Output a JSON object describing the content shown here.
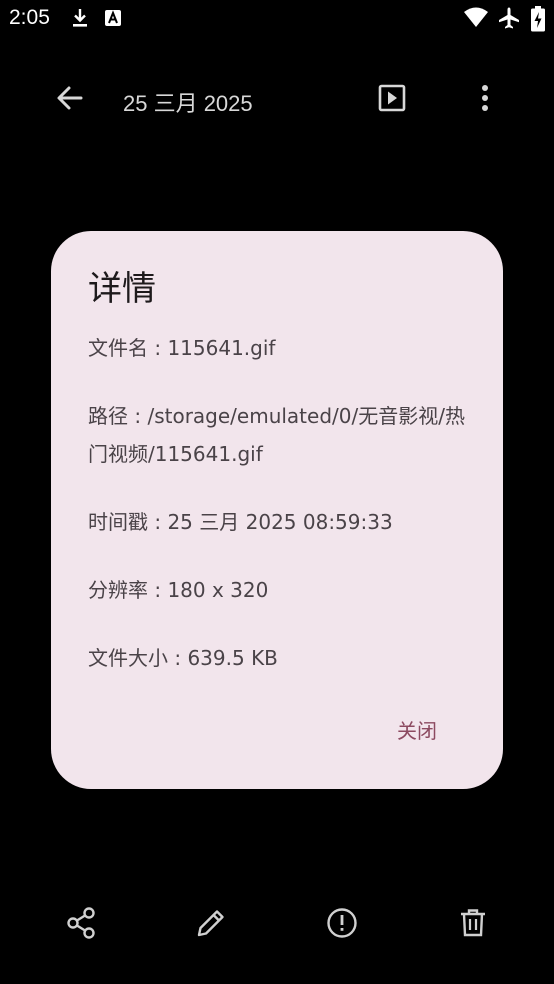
{
  "status_bar": {
    "time": "2:05",
    "icons": [
      "download-icon",
      "text-a-icon",
      "wifi-icon",
      "airplane-mode-icon",
      "battery-icon"
    ]
  },
  "app_bar": {
    "title": "25 三月 2025",
    "back_icon": "arrow-back-icon",
    "play_icon": "slideshow-play-icon",
    "more_icon": "more-vert-icon"
  },
  "dialog": {
    "title": "详情",
    "filename": "文件名 : 115641.gif",
    "path": "路径 : /storage/emulated/0/无音影视/热门视频/115641.gif",
    "timestamp": "时间戳 : 25 三月 2025 08:59:33",
    "resolution": "分辨率 : 180 x 320",
    "size": "文件大小 : 639.5 KB",
    "close_label": "关闭",
    "accent_color": "#8c4a60",
    "background_color": "#f2e5ec"
  },
  "bottom_bar": {
    "icons": [
      "share-icon",
      "edit-icon",
      "info-icon",
      "delete-icon"
    ]
  }
}
